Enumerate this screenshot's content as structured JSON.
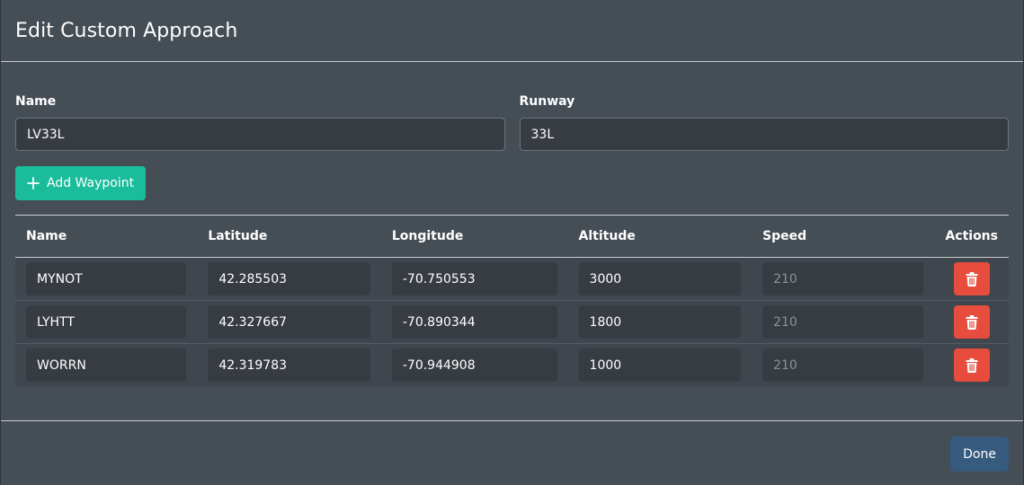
{
  "modal": {
    "title": "Edit Custom Approach"
  },
  "form": {
    "name_label": "Name",
    "name_value": "LV33L",
    "runway_label": "Runway",
    "runway_value": "33L",
    "add_waypoint_label": "Add Waypoint"
  },
  "table": {
    "headers": {
      "name": "Name",
      "latitude": "Latitude",
      "longitude": "Longitude",
      "altitude": "Altitude",
      "speed": "Speed",
      "actions": "Actions"
    },
    "rows": [
      {
        "name": "MYNOT",
        "latitude": "42.285503",
        "longitude": "-70.750553",
        "altitude": "3000",
        "speed_placeholder": "210"
      },
      {
        "name": "LYHTT",
        "latitude": "42.327667",
        "longitude": "-70.890344",
        "altitude": "1800",
        "speed_placeholder": "210"
      },
      {
        "name": "WORRN",
        "latitude": "42.319783",
        "longitude": "-70.944908",
        "altitude": "1000",
        "speed_placeholder": "210"
      }
    ]
  },
  "footer": {
    "done_label": "Done"
  },
  "colors": {
    "modal_bg": "#454d55",
    "input_bg": "#373c43",
    "add_button": "#1abc9c",
    "delete_button": "#e74c3c",
    "done_button": "#375a7f"
  },
  "icons": {
    "add": "plus-icon",
    "delete": "trash-icon"
  }
}
